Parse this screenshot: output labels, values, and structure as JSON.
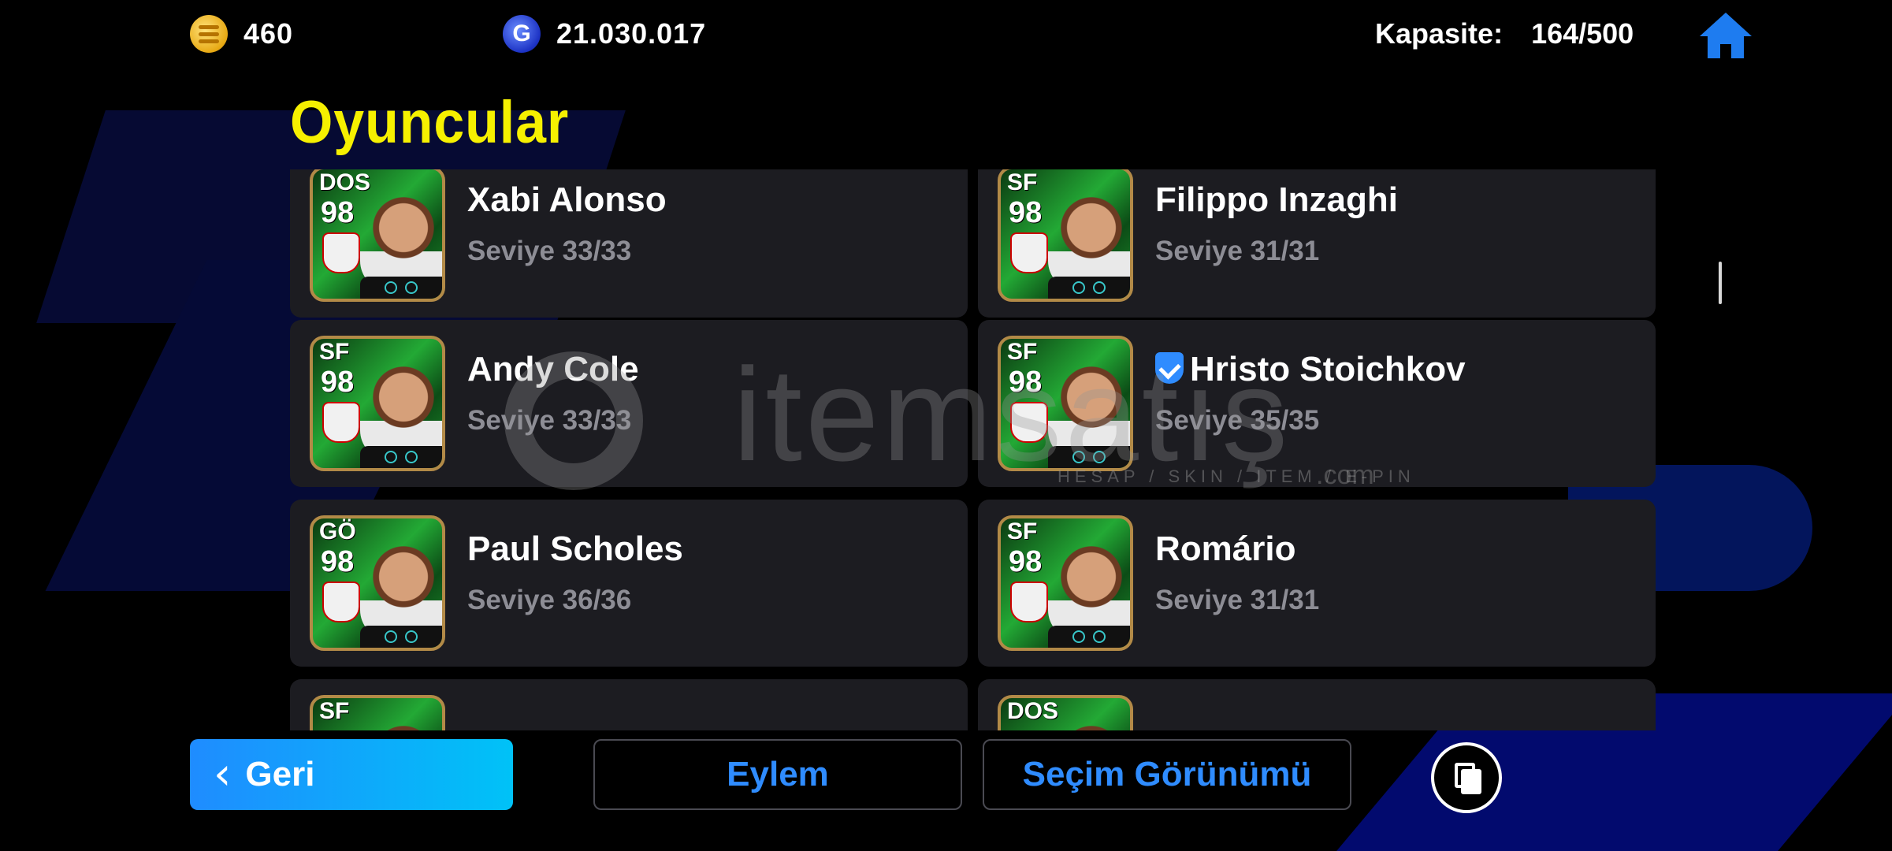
{
  "header": {
    "coins": "460",
    "gp": "21.030.017",
    "capacity_label": "Kapasite:",
    "capacity_value": "164/500",
    "coin_icon": "efootball-coin-icon",
    "gp_icon": "gp-icon",
    "home_icon": "home-icon"
  },
  "page_title": "Oyuncular",
  "players": [
    {
      "position": "DOS",
      "rating": "98",
      "name": "Xabi Alonso",
      "level": "Seviye 33/33",
      "verified": false
    },
    {
      "position": "SF",
      "rating": "98",
      "name": "Filippo Inzaghi",
      "level": "Seviye 31/31",
      "verified": false
    },
    {
      "position": "SF",
      "rating": "98",
      "name": "Andy Cole",
      "level": "Seviye 33/33",
      "verified": false
    },
    {
      "position": "SF",
      "rating": "98",
      "name": "Hristo Stoichkov",
      "level": "Seviye 35/35",
      "verified": true
    },
    {
      "position": "GÖ",
      "rating": "98",
      "name": "Paul Scholes",
      "level": "Seviye 36/36",
      "verified": false
    },
    {
      "position": "SF",
      "rating": "98",
      "name": "Romário",
      "level": "Seviye 31/31",
      "verified": false
    },
    {
      "position": "SF",
      "rating": "",
      "name": "",
      "level": "",
      "verified": false
    },
    {
      "position": "DOS",
      "rating": "",
      "name": "",
      "level": "",
      "verified": false
    }
  ],
  "watermark": {
    "brand": "itemsatış",
    "tagline": "HESAP / SKIN / ITEM / E-PIN",
    "suffix": ".com"
  },
  "footer": {
    "back_label": "Geri",
    "action_label": "Eylem",
    "selection_view_label": "Seçim Görünümü",
    "pages_icon": "pages-icon"
  },
  "colors": {
    "title": "#f6f000",
    "accent_blue": "#2f8cff",
    "card_bg": "#1c1c21",
    "level_text": "#8d8d95"
  }
}
